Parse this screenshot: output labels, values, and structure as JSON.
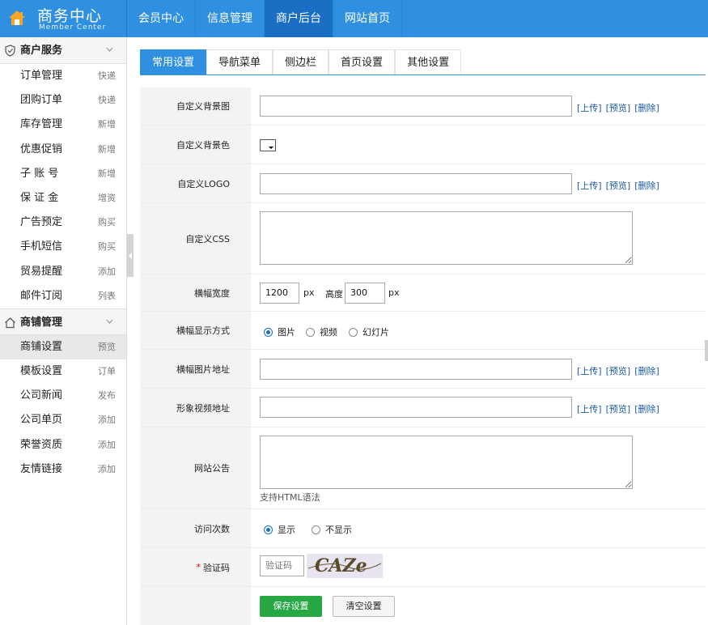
{
  "brand": {
    "title": "商务中心",
    "subtitle": "Member Center"
  },
  "topnav": [
    {
      "label": "会员中心",
      "active": false
    },
    {
      "label": "信息管理",
      "active": false
    },
    {
      "label": "商户后台",
      "active": true
    },
    {
      "label": "网站首页",
      "active": false
    }
  ],
  "sidebar": {
    "groups": [
      {
        "title": "商户服务",
        "icon": "shield-icon",
        "items": [
          {
            "label": "订单管理",
            "tag": "快递"
          },
          {
            "label": "团购订单",
            "tag": "快递"
          },
          {
            "label": "库存管理",
            "tag": "新增"
          },
          {
            "label": "优惠促销",
            "tag": "新增"
          },
          {
            "label": "子 账 号",
            "tag": "新增"
          },
          {
            "label": "保 证 金",
            "tag": "增资"
          },
          {
            "label": "广告预定",
            "tag": "购买"
          },
          {
            "label": "手机短信",
            "tag": "购买"
          },
          {
            "label": "贸易提醒",
            "tag": "添加"
          },
          {
            "label": "邮件订阅",
            "tag": "列表"
          }
        ]
      },
      {
        "title": "商铺管理",
        "icon": "home-icon",
        "items": [
          {
            "label": "商铺设置",
            "tag": "预览",
            "active": true
          },
          {
            "label": "模板设置",
            "tag": "订单"
          },
          {
            "label": "公司新闻",
            "tag": "发布"
          },
          {
            "label": "公司单页",
            "tag": "添加"
          },
          {
            "label": "荣誉资质",
            "tag": "添加"
          },
          {
            "label": "友情链接",
            "tag": "添加"
          }
        ]
      }
    ]
  },
  "tabs": [
    {
      "label": "常用设置",
      "active": true
    },
    {
      "label": "导航菜单"
    },
    {
      "label": "侧边栏"
    },
    {
      "label": "首页设置"
    },
    {
      "label": "其他设置"
    }
  ],
  "links": {
    "upload": "[上传]",
    "preview": "[预览]",
    "delete": "[删除]"
  },
  "form": {
    "bg_image": {
      "label": "自定义背景图",
      "value": ""
    },
    "bg_color": {
      "label": "自定义背景色"
    },
    "logo": {
      "label": "自定义LOGO",
      "value": ""
    },
    "css": {
      "label": "自定义CSS",
      "value": ""
    },
    "banner_size": {
      "label": "横幅宽度",
      "width": "1200",
      "unit": "px",
      "height_label": "高度",
      "height": "300"
    },
    "banner_mode": {
      "label": "横幅显示方式",
      "options": [
        "图片",
        "视频",
        "幻灯片"
      ],
      "selected": 0
    },
    "banner_url": {
      "label": "横幅图片地址",
      "value": ""
    },
    "video_url": {
      "label": "形象视频地址",
      "value": ""
    },
    "notice": {
      "label": "网站公告",
      "value": "",
      "hint": "支持HTML语法"
    },
    "visits": {
      "label": "访问次数",
      "options": [
        "显示",
        "不显示"
      ],
      "selected": 0
    },
    "captcha": {
      "required": "*",
      "label": "验证码",
      "placeholder": "验证码",
      "image_text": "CAZe"
    },
    "save_label": "保存设置",
    "clear_label": "清空设置"
  },
  "colors": {
    "header": "#2f8fe0",
    "header_active": "#1a6fc4",
    "save": "#28a745",
    "link": "#1a5aa8"
  }
}
